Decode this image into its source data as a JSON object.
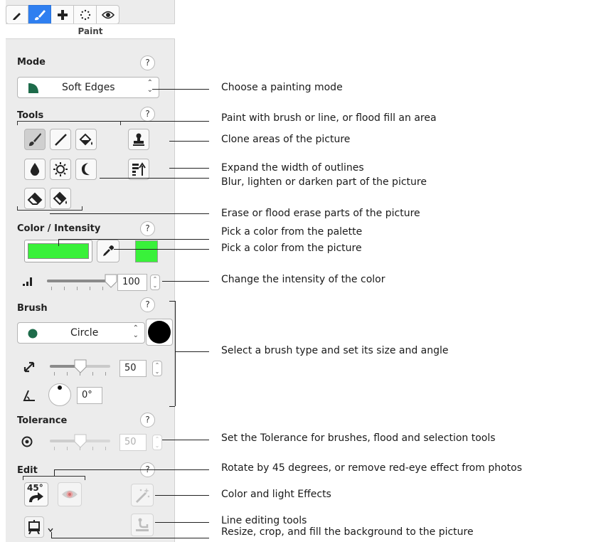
{
  "panel": {
    "title": "Paint",
    "tabs": [
      {
        "icon": "pencil-icon"
      },
      {
        "icon": "paint-brush-icon",
        "active": true
      },
      {
        "icon": "plus-icon"
      },
      {
        "icon": "selection-dots-icon"
      },
      {
        "icon": "eye-icon"
      }
    ]
  },
  "mode": {
    "label": "Mode",
    "help": "?",
    "value": "Soft Edges"
  },
  "tools": {
    "label": "Tools",
    "help": "?"
  },
  "color": {
    "label": "Color / Intensity",
    "help": "?",
    "swatch_color": "#39f13a",
    "intensity_value": "100",
    "intensity_fraction": 1.0
  },
  "brush": {
    "label": "Brush",
    "help": "?",
    "type": "Circle",
    "size_value": "50",
    "size_fraction": 0.5,
    "angle_value": "0°"
  },
  "tolerance": {
    "label": "Tolerance",
    "help": "?",
    "value": "50",
    "fraction": 0.5
  },
  "edit": {
    "label": "Edit",
    "help": "?",
    "rotate_label": "45°"
  },
  "callouts": {
    "mode": "Choose a painting mode",
    "brush_tools": "Paint with brush or line, or flood fill an area",
    "clone": "Clone areas of the picture",
    "expand": "Expand the width of outlines",
    "blur": "Blur, lighten or darken part of the picture",
    "erase": "Erase or flood erase parts of the picture",
    "palette": "Pick a color from the palette",
    "picker": "Pick a color from the picture",
    "intensity": "Change the intensity of the color",
    "brush": "Select a brush type and set its size and angle",
    "tolerance": "Set the Tolerance for brushes, flood and selection tools",
    "rotate": "Rotate by 45 degrees, or remove red-eye effect from photos",
    "effects": "Color and light Effects",
    "line_edit": "Line editing tools",
    "resize": "Resize, crop, and fill the background to the picture"
  }
}
